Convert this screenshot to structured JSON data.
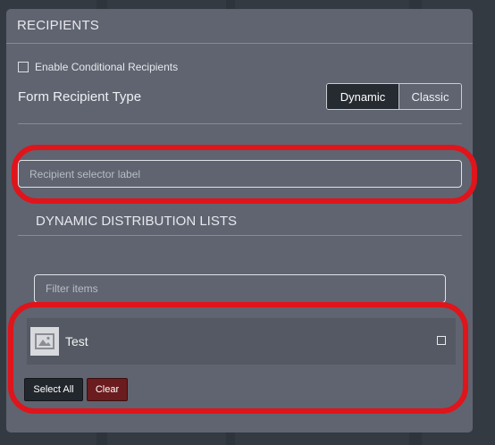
{
  "panel": {
    "title": "RECIPIENTS",
    "enable_conditional_label": "Enable Conditional Recipients",
    "enable_conditional_checked": false,
    "form_recipient_type_label": "Form Recipient Type",
    "recipient_type_options": [
      "Dynamic",
      "Classic"
    ],
    "recipient_type_selected": "Dynamic",
    "recipient_selector_placeholder": "Recipient selector label",
    "distribution_section_title": "DYNAMIC DISTRIBUTION LISTS",
    "filter_placeholder": "Filter items",
    "list_items": [
      {
        "label": "Test",
        "icon": "image-icon",
        "checked": false
      }
    ],
    "select_all_label": "Select All",
    "clear_label": "Clear"
  },
  "colors": {
    "panel_bg": "#5f6470",
    "page_bg": "#343a42",
    "selected_segment_bg": "#262b31",
    "clear_button_bg": "#6b1c1e",
    "highlight_annotation": "#e0141b"
  }
}
